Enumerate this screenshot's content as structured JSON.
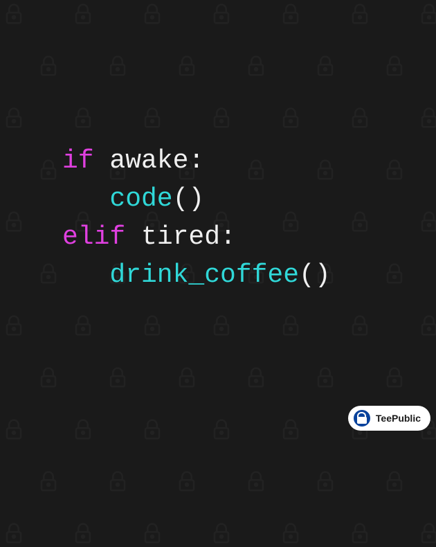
{
  "code": {
    "line1": {
      "keyword": "if",
      "condition": " awake:"
    },
    "line2": {
      "func": "code",
      "parens": "()"
    },
    "line3": {
      "keyword": "elif",
      "condition": " tired:"
    },
    "line4": {
      "func": "drink_coffee",
      "parens": "()"
    }
  },
  "badge": {
    "brand": "TeePublic"
  },
  "colors": {
    "keyword": "#e040e0",
    "identifier": "#f0f0f0",
    "func": "#30d8d8",
    "background": "#1a1a1a"
  }
}
